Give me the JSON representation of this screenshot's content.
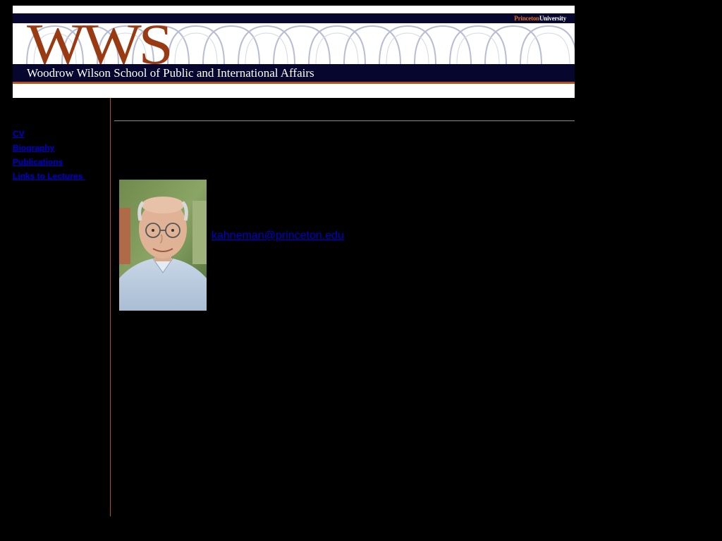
{
  "banner": {
    "logo_text": "WWS",
    "school_name": "Woodrow Wilson School of Public and International Affairs",
    "wordmark_princeton": "Princeton",
    "wordmark_university": "University",
    "colors": {
      "navy": "#06062e",
      "rust": "#9a3a12",
      "orange": "#b0501a"
    }
  },
  "sidebar": {
    "items": [
      {
        "label": "CV"
      },
      {
        "label": "Biography"
      },
      {
        "label": "Publications"
      },
      {
        "label": "Links to Lectures "
      }
    ]
  },
  "main": {
    "email": "kahneman@princeton.edu",
    "portrait_icon": "portrait-photo"
  },
  "colors": {
    "background": "#000000",
    "link": "#0000cc"
  }
}
